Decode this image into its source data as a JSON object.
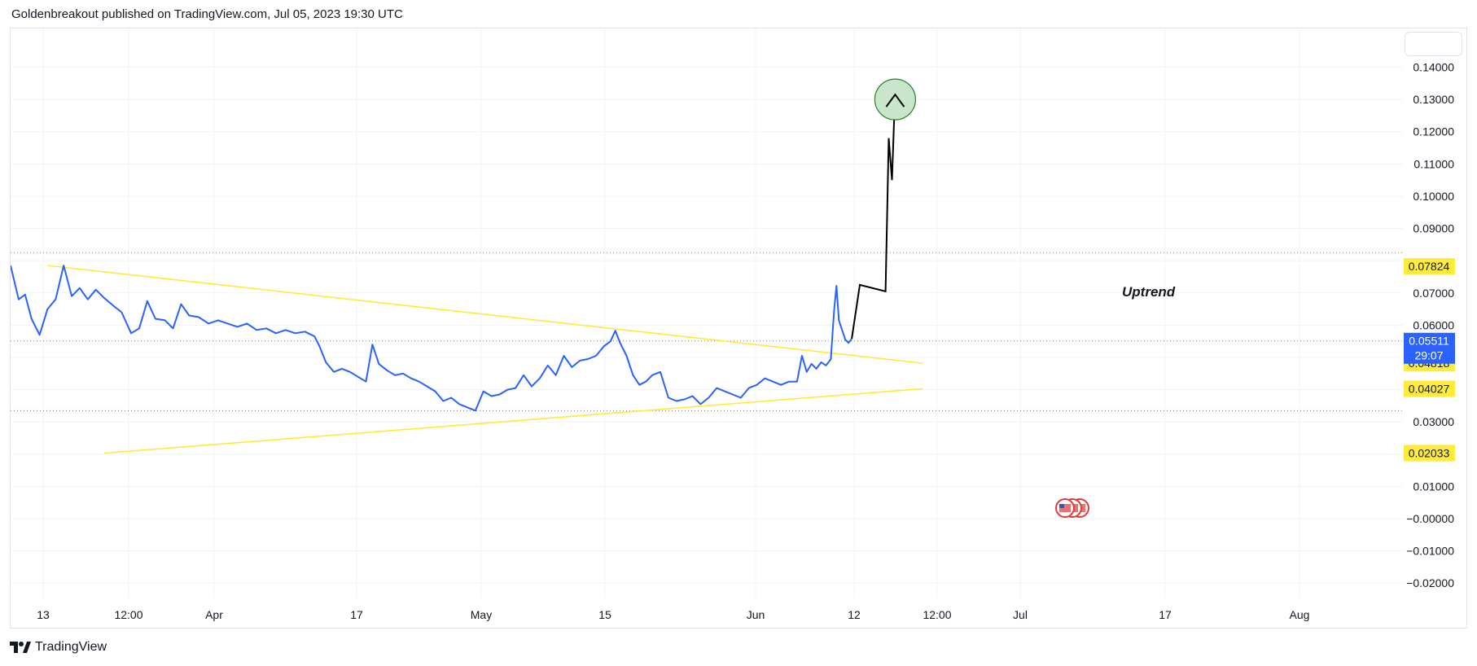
{
  "header": {
    "text": "Goldenbreakout published on TradingView.com, Jul 05, 2023 19:30 UTC"
  },
  "footer": {
    "brand": "TradingView",
    "logo_icon": "tradingview-logo-icon"
  },
  "colors": {
    "price_line": "#2962ff",
    "trendline": "#ffeb3b",
    "projection": "#000000",
    "target_circle_fill": "#c8e6c9",
    "target_circle_stroke": "#2e7d32",
    "level_dotted": "#9c6f7a",
    "current_tag_bg": "#2962ff",
    "level_tag_bg": "#ffeb3b",
    "grid": "#f0f3fa"
  },
  "chart_data": {
    "type": "line",
    "title": "",
    "xlabel": "",
    "ylabel": "",
    "x_ticks": [
      "13",
      "12:00",
      "Apr",
      "17",
      "May",
      "15",
      "Jun",
      "12",
      "12:00",
      "Jul",
      "17",
      "Aug"
    ],
    "y_ticks": [
      "0.14000",
      "0.13000",
      "0.12000",
      "0.11000",
      "0.10000",
      "0.09000",
      "0.07000",
      "0.06000",
      "0.03000",
      "0.01000",
      "−0.00000",
      "−0.01000",
      "−0.02000"
    ],
    "ylim": [
      -0.026,
      0.152
    ],
    "grid": true,
    "series": [
      {
        "values": [
          [
            0.0,
            0.0785
          ],
          [
            0.5,
            0.068
          ],
          [
            0.9,
            0.0695
          ],
          [
            1.3,
            0.062
          ],
          [
            1.8,
            0.057
          ],
          [
            2.3,
            0.065
          ],
          [
            2.8,
            0.068
          ],
          [
            3.3,
            0.0785
          ],
          [
            3.8,
            0.069
          ],
          [
            4.3,
            0.0715
          ],
          [
            4.8,
            0.068
          ],
          [
            5.3,
            0.071
          ],
          [
            5.8,
            0.0685
          ],
          [
            6.4,
            0.066
          ],
          [
            6.9,
            0.064
          ],
          [
            7.5,
            0.0575
          ],
          [
            8.0,
            0.059
          ],
          [
            8.5,
            0.0675
          ],
          [
            9.0,
            0.062
          ],
          [
            9.6,
            0.0615
          ],
          [
            10.1,
            0.059
          ],
          [
            10.6,
            0.0665
          ],
          [
            11.1,
            0.063
          ],
          [
            11.7,
            0.0625
          ],
          [
            12.3,
            0.0605
          ],
          [
            12.9,
            0.0615
          ],
          [
            13.5,
            0.0605
          ],
          [
            14.1,
            0.0595
          ],
          [
            14.7,
            0.0605
          ],
          [
            15.3,
            0.0585
          ],
          [
            15.9,
            0.059
          ],
          [
            16.5,
            0.0575
          ],
          [
            17.1,
            0.0585
          ],
          [
            17.7,
            0.0575
          ],
          [
            18.3,
            0.058
          ],
          [
            18.9,
            0.0565
          ],
          [
            19.2,
            0.0535
          ],
          [
            19.6,
            0.0485
          ],
          [
            20.1,
            0.0455
          ],
          [
            20.6,
            0.0465
          ],
          [
            21.1,
            0.0455
          ],
          [
            21.6,
            0.044
          ],
          [
            22.1,
            0.0425
          ],
          [
            22.5,
            0.054
          ],
          [
            22.9,
            0.048
          ],
          [
            23.4,
            0.046
          ],
          [
            23.9,
            0.0445
          ],
          [
            24.4,
            0.045
          ],
          [
            24.9,
            0.0435
          ],
          [
            25.4,
            0.0425
          ],
          [
            25.9,
            0.041
          ],
          [
            26.4,
            0.0395
          ],
          [
            26.9,
            0.0365
          ],
          [
            27.4,
            0.0375
          ],
          [
            27.9,
            0.0355
          ],
          [
            28.4,
            0.0345
          ],
          [
            28.9,
            0.0335
          ],
          [
            29.4,
            0.0395
          ],
          [
            29.9,
            0.038
          ],
          [
            30.4,
            0.0385
          ],
          [
            30.9,
            0.04
          ],
          [
            31.4,
            0.0405
          ],
          [
            31.9,
            0.0445
          ],
          [
            32.4,
            0.041
          ],
          [
            32.9,
            0.0435
          ],
          [
            33.4,
            0.0475
          ],
          [
            33.9,
            0.0445
          ],
          [
            34.4,
            0.0505
          ],
          [
            34.9,
            0.047
          ],
          [
            35.4,
            0.049
          ],
          [
            35.9,
            0.0495
          ],
          [
            36.4,
            0.0505
          ],
          [
            36.9,
            0.0535
          ],
          [
            37.3,
            0.055
          ],
          [
            37.6,
            0.0583
          ],
          [
            37.9,
            0.0545
          ],
          [
            38.3,
            0.0505
          ],
          [
            38.7,
            0.0445
          ],
          [
            39.1,
            0.0415
          ],
          [
            39.5,
            0.0425
          ],
          [
            39.9,
            0.0445
          ],
          [
            40.4,
            0.0455
          ],
          [
            40.9,
            0.0375
          ],
          [
            41.4,
            0.0365
          ],
          [
            41.9,
            0.037
          ],
          [
            42.4,
            0.038
          ],
          [
            42.9,
            0.0355
          ],
          [
            43.4,
            0.0375
          ],
          [
            43.9,
            0.0405
          ],
          [
            44.4,
            0.0395
          ],
          [
            44.9,
            0.0385
          ],
          [
            45.4,
            0.0375
          ],
          [
            45.9,
            0.0405
          ],
          [
            46.4,
            0.0415
          ],
          [
            46.9,
            0.0435
          ],
          [
            47.4,
            0.0425
          ],
          [
            47.9,
            0.0415
          ],
          [
            48.4,
            0.0425
          ],
          [
            48.9,
            0.0425
          ],
          [
            49.2,
            0.0505
          ],
          [
            49.5,
            0.0455
          ],
          [
            49.8,
            0.048
          ],
          [
            50.1,
            0.0465
          ],
          [
            50.4,
            0.0485
          ],
          [
            50.7,
            0.0475
          ],
          [
            51.0,
            0.0495
          ],
          [
            51.2,
            0.0645
          ],
          [
            51.35,
            0.0722
          ],
          [
            51.5,
            0.0615
          ],
          [
            51.7,
            0.0585
          ],
          [
            51.9,
            0.0555
          ],
          [
            52.1,
            0.0545
          ],
          [
            52.3,
            0.0558
          ]
        ]
      }
    ],
    "levels": {
      "current": {
        "value": "0.05511",
        "timer": "29:07"
      },
      "tags": [
        "0.07824",
        "0.04818",
        "0.04027",
        "0.02033"
      ],
      "dotted_lines": [
        0.0825,
        0.0551,
        0.0335
      ]
    },
    "trendlines": [
      {
        "name": "upper",
        "from": [
          2.3,
          0.0785
        ],
        "to": [
          56.7,
          0.0482
        ]
      },
      {
        "name": "lower",
        "from": [
          5.8,
          0.0203
        ],
        "to": [
          56.7,
          0.0403
        ]
      }
    ],
    "projection": [
      [
        52.3,
        0.0558
      ],
      [
        52.8,
        0.0725
      ],
      [
        54.4,
        0.0705
      ],
      [
        54.6,
        0.118
      ],
      [
        54.8,
        0.105
      ],
      [
        55.0,
        0.133
      ]
    ],
    "target_value": 0.13,
    "annotation": {
      "text": "Uptrend"
    },
    "events_icon": "us-flag-icon"
  }
}
